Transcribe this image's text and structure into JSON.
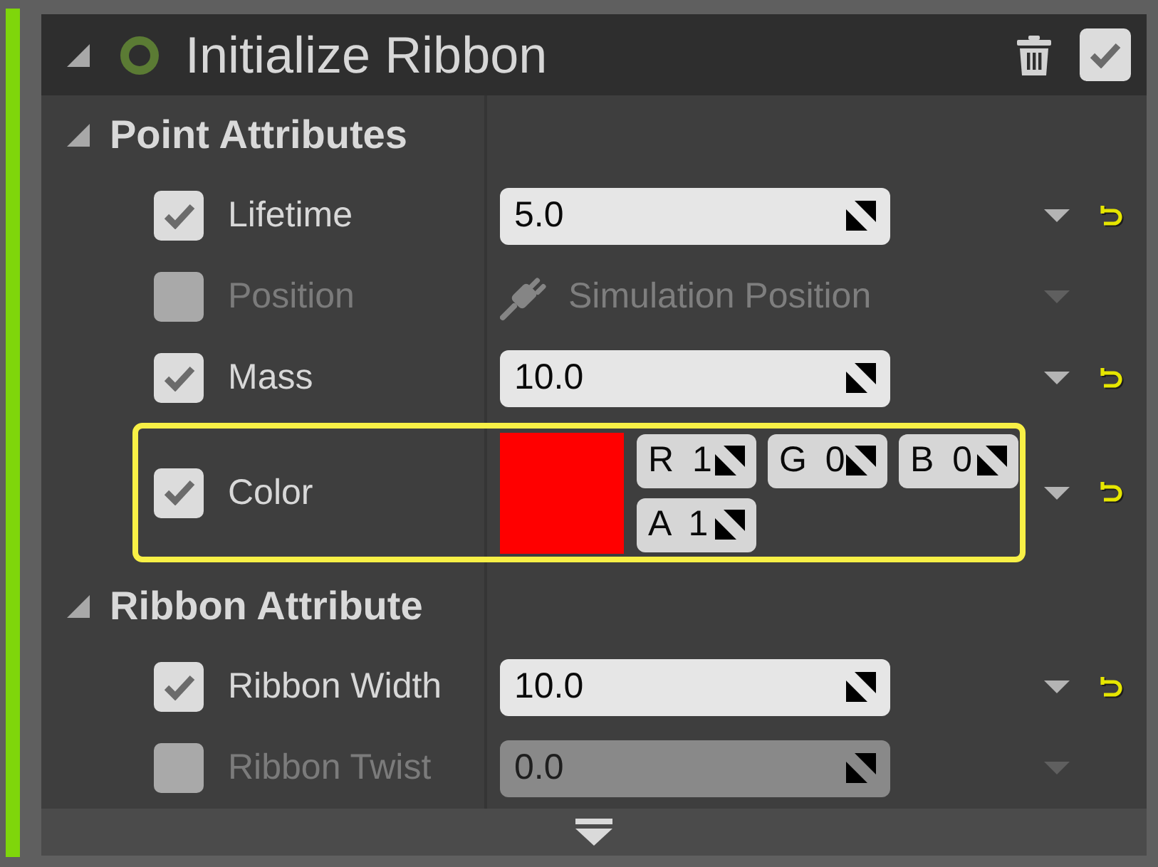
{
  "node": {
    "title": "Initialize Ribbon",
    "expanded": true,
    "enabled": true
  },
  "sections": [
    {
      "title": "Point Attributes",
      "expanded": true,
      "rows": [
        {
          "kind": "number",
          "label": "Lifetime",
          "checked": true,
          "selected": false,
          "value": "5.0"
        },
        {
          "kind": "binding",
          "label": "Position",
          "checked": false,
          "selected": false,
          "value": "Simulation Position"
        },
        {
          "kind": "number",
          "label": "Mass",
          "checked": true,
          "selected": false,
          "value": "10.0"
        },
        {
          "kind": "color",
          "label": "Color",
          "checked": true,
          "selected": true,
          "color": "#ff0000",
          "components": [
            {
              "channel": "R",
              "value": "1"
            },
            {
              "channel": "G",
              "value": "0"
            },
            {
              "channel": "B",
              "value": "0"
            },
            {
              "channel": "A",
              "value": "1"
            }
          ]
        }
      ]
    },
    {
      "title": "Ribbon Attribute",
      "expanded": true,
      "rows": [
        {
          "kind": "number",
          "label": "Ribbon Width",
          "checked": true,
          "selected": false,
          "value": "10.0"
        },
        {
          "kind": "number",
          "label": "Ribbon Twist",
          "checked": false,
          "selected": false,
          "value": "0.0"
        }
      ]
    }
  ]
}
